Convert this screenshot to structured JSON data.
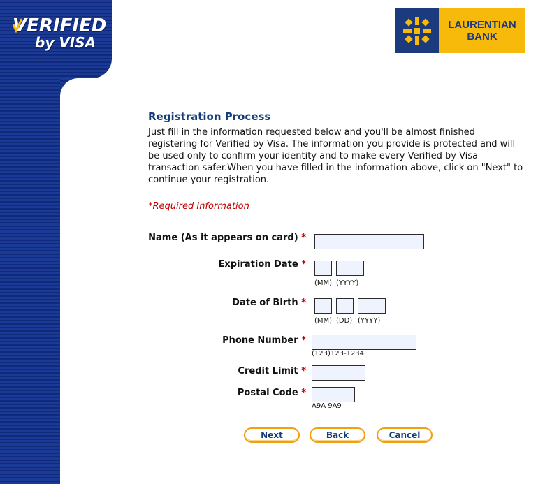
{
  "header": {
    "vbv_logo_line1": "VERIFIED",
    "vbv_logo_line2": "by VISA",
    "bank_name_line1": "LAURENTIAN",
    "bank_name_line2": "BANK"
  },
  "main": {
    "title": "Registration Process",
    "intro": "Just fill in the information requested below and you'll be almost finished registering for Verified by Visa. The information you provide is protected and will be used only to confirm your identity and to make every Verified by Visa transaction safer.When you have filled in the information above, click on \"Next\" to continue your registration.",
    "required_note": "*Required Information"
  },
  "form": {
    "required_mark": "*",
    "name_label": "Name (As it appears on card)",
    "expiration_label": "Expiration Date",
    "expiration_hint_mm": "(MM)",
    "expiration_hint_yyyy": "(YYYY)",
    "dob_label": "Date of Birth",
    "dob_hint_mm": "(MM)",
    "dob_hint_dd": "(DD)",
    "dob_hint_yyyy": "(YYYY)",
    "phone_label": "Phone Number",
    "phone_hint": "(123)123-1234",
    "credit_limit_label": "Credit Limit",
    "postal_label": "Postal Code",
    "postal_hint": "A9A 9A9",
    "name_value": "",
    "exp_mm_value": "",
    "exp_yyyy_value": "",
    "dob_mm_value": "",
    "dob_dd_value": "",
    "dob_yyyy_value": "",
    "phone_value": "",
    "credit_limit_value": "",
    "postal_value": ""
  },
  "buttons": {
    "next": "Next",
    "back": "Back",
    "cancel": "Cancel"
  },
  "colors": {
    "sidebar_blue": "#1a3a95",
    "title_blue": "#163d7a",
    "required_red": "#c00000",
    "field_bg": "#eef3fd",
    "button_border": "#f0a010",
    "bank_yellow": "#f7b90a"
  },
  "icons": {
    "visa_check": "checkmark-icon",
    "bank_emblem": "maple-emblem-icon"
  }
}
